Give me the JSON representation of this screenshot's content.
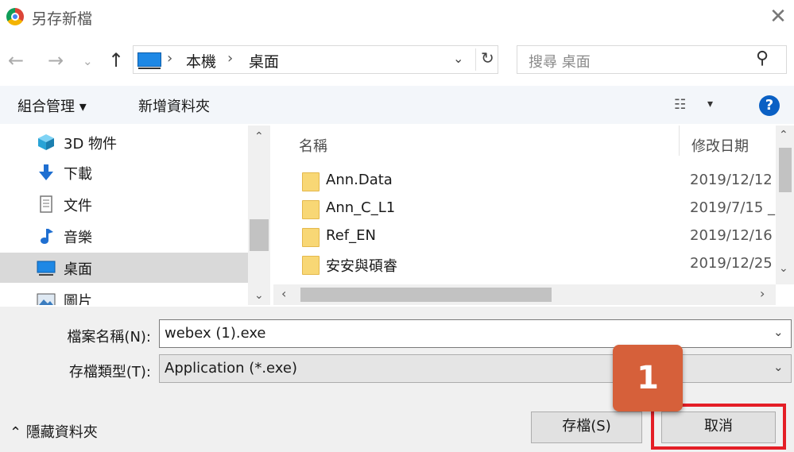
{
  "window": {
    "title": "另存新檔",
    "close_glyph": "✕"
  },
  "nav": {
    "back_glyph": "←",
    "forward_glyph": "→",
    "recent_glyph": "⌄",
    "up_glyph": "↑",
    "breadcrumb": [
      "本機",
      "桌面"
    ],
    "separator": "›",
    "address_dropdown_glyph": "⌄",
    "refresh_glyph": "↻",
    "search_placeholder": "搜尋 桌面",
    "search_glyph": "⚲"
  },
  "toolbar": {
    "organize_label": "組合管理 ▾",
    "new_folder_label": "新增資料夾",
    "view_glyph": "☷",
    "view_dropdown_glyph": "▾",
    "help_glyph": "?"
  },
  "sidebar": {
    "items": [
      {
        "label": "3D 物件",
        "icon": "cube-3d-icon"
      },
      {
        "label": "下載",
        "icon": "download-arrow-icon"
      },
      {
        "label": "文件",
        "icon": "document-icon"
      },
      {
        "label": "音樂",
        "icon": "music-note-icon"
      },
      {
        "label": "桌面",
        "icon": "desktop-icon",
        "selected": true
      },
      {
        "label": "圖片",
        "icon": "pictures-icon"
      }
    ],
    "scroll_up_glyph": "⌃",
    "scroll_down_glyph": "⌄"
  },
  "files": {
    "sort_glyph": "⌃",
    "columns": [
      "名稱",
      "修改日期"
    ],
    "rows": [
      {
        "name": "Ann.Data",
        "date": "2019/12/12"
      },
      {
        "name": "Ann_C_L1",
        "date": "2019/7/15 _"
      },
      {
        "name": "Ref_EN",
        "date": "2019/12/16"
      },
      {
        "name": "安安與碩睿",
        "date": "2019/12/25"
      }
    ],
    "scroll_left_glyph": "‹",
    "scroll_right_glyph": "›",
    "scroll_up_glyph": "⌃",
    "scroll_down_glyph": "⌄"
  },
  "form": {
    "filename_label": "檔案名稱(N):",
    "filename_value": "webex (1).exe",
    "filetype_label": "存檔類型(T):",
    "filetype_value": "Application (*.exe)",
    "dropdown_glyph": "⌄"
  },
  "footer": {
    "hide_folders_label": "⌃ 隱藏資料夾",
    "save_label": "存檔(S)",
    "cancel_label": "取消"
  },
  "annotation": {
    "step_number": "1",
    "badge_color": "#d6603a",
    "highlight_color": "#e41e26"
  }
}
